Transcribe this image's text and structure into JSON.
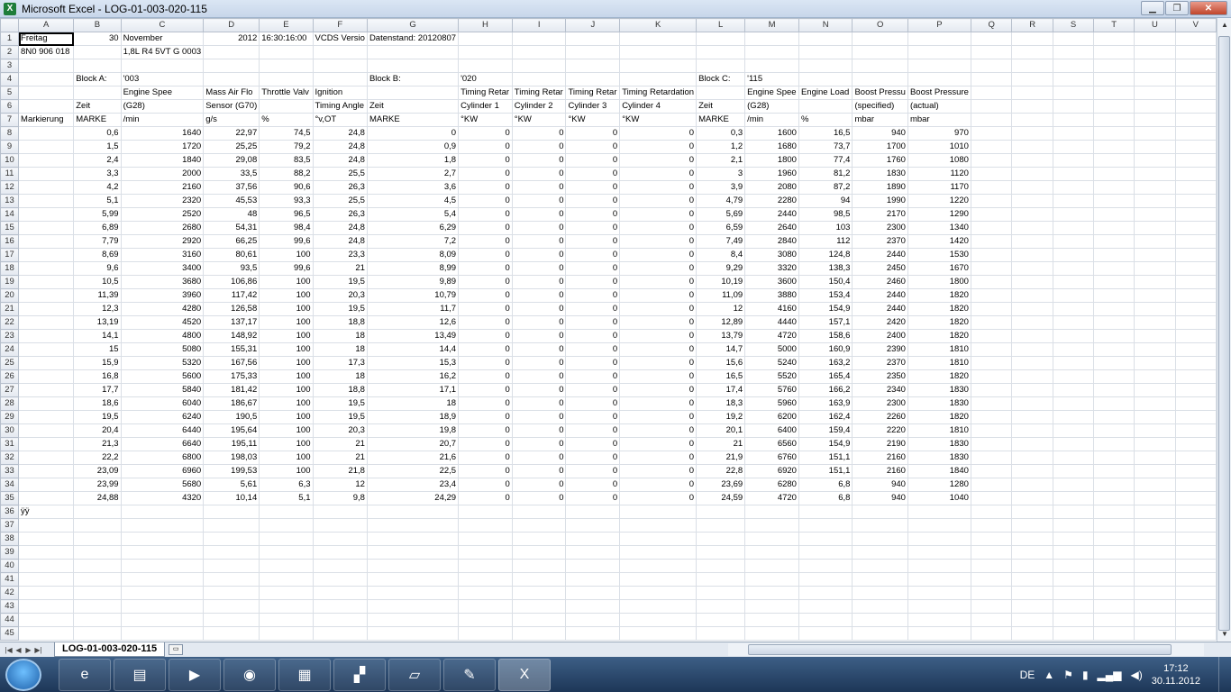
{
  "window": {
    "title": "Microsoft Excel - LOG-01-003-020-115",
    "app_icon": "X",
    "minimize": "▁",
    "maximize": "❐",
    "close": "✕"
  },
  "columns": [
    "A",
    "B",
    "C",
    "D",
    "E",
    "F",
    "G",
    "H",
    "I",
    "J",
    "K",
    "L",
    "M",
    "N",
    "O",
    "P",
    "Q",
    "R",
    "S",
    "T",
    "U",
    "V"
  ],
  "rows": [
    [
      "Freitag",
      "30",
      "November",
      "2012",
      "16:30:16:00",
      "VCDS Versio",
      "Datenstand: 20120807",
      "",
      "",
      "",
      "",
      "",
      "",
      "",
      "",
      "",
      "",
      "",
      "",
      "",
      "",
      ""
    ],
    [
      "8N0 906 018",
      "",
      "1,8L R4 5VT   G  0003",
      "",
      "",
      "",
      "",
      "",
      "",
      "",
      "",
      "",
      "",
      "",
      "",
      "",
      "",
      "",
      "",
      "",
      "",
      ""
    ],
    [
      "",
      "",
      "",
      "",
      "",
      "",
      "",
      "",
      "",
      "",
      "",
      "",
      "",
      "",
      "",
      "",
      "",
      "",
      "",
      "",
      "",
      ""
    ],
    [
      "",
      "Block A:",
      "'003",
      "",
      "",
      "",
      "Block B:",
      "'020",
      "",
      "",
      "",
      "Block C:",
      "'115",
      "",
      "",
      "",
      "",
      "",
      "",
      "",
      "",
      ""
    ],
    [
      "",
      "",
      "Engine Spee",
      "Mass Air Flo",
      "Throttle Valv",
      "Ignition",
      "",
      "Timing Retar",
      "Timing Retar",
      "Timing Retar",
      "Timing Retardation",
      "",
      "Engine Spee",
      "Engine Load",
      "Boost Pressu",
      "Boost Pressure",
      "",
      "",
      "",
      "",
      "",
      ""
    ],
    [
      "",
      "Zeit",
      "(G28)",
      "Sensor (G70)",
      "",
      "Timing Angle",
      "Zeit",
      "Cylinder 1",
      "Cylinder 2",
      "Cylinder 3",
      "Cylinder 4",
      "Zeit",
      "(G28)",
      "",
      "(specified)",
      "(actual)",
      "",
      "",
      "",
      "",
      "",
      ""
    ],
    [
      "Markierung",
      "MARKE",
      "/min",
      "g/s",
      "%",
      "°v,OT",
      "MARKE",
      "°KW",
      "°KW",
      "°KW",
      "°KW",
      "MARKE",
      "/min",
      "%",
      "mbar",
      "mbar",
      "",
      "",
      "",
      "",
      "",
      ""
    ],
    [
      "",
      "0,6",
      "1640",
      "22,97",
      "74,5",
      "24,8",
      "0",
      "0",
      "0",
      "0",
      "0",
      "0,3",
      "1600",
      "16,5",
      "940",
      "970",
      "",
      "",
      "",
      "",
      "",
      ""
    ],
    [
      "",
      "1,5",
      "1720",
      "25,25",
      "79,2",
      "24,8",
      "0,9",
      "0",
      "0",
      "0",
      "0",
      "1,2",
      "1680",
      "73,7",
      "1700",
      "1010",
      "",
      "",
      "",
      "",
      "",
      ""
    ],
    [
      "",
      "2,4",
      "1840",
      "29,08",
      "83,5",
      "24,8",
      "1,8",
      "0",
      "0",
      "0",
      "0",
      "2,1",
      "1800",
      "77,4",
      "1760",
      "1080",
      "",
      "",
      "",
      "",
      "",
      ""
    ],
    [
      "",
      "3,3",
      "2000",
      "33,5",
      "88,2",
      "25,5",
      "2,7",
      "0",
      "0",
      "0",
      "0",
      "3",
      "1960",
      "81,2",
      "1830",
      "1120",
      "",
      "",
      "",
      "",
      "",
      ""
    ],
    [
      "",
      "4,2",
      "2160",
      "37,56",
      "90,6",
      "26,3",
      "3,6",
      "0",
      "0",
      "0",
      "0",
      "3,9",
      "2080",
      "87,2",
      "1890",
      "1170",
      "",
      "",
      "",
      "",
      "",
      ""
    ],
    [
      "",
      "5,1",
      "2320",
      "45,53",
      "93,3",
      "25,5",
      "4,5",
      "0",
      "0",
      "0",
      "0",
      "4,79",
      "2280",
      "94",
      "1990",
      "1220",
      "",
      "",
      "",
      "",
      "",
      ""
    ],
    [
      "",
      "5,99",
      "2520",
      "48",
      "96,5",
      "26,3",
      "5,4",
      "0",
      "0",
      "0",
      "0",
      "5,69",
      "2440",
      "98,5",
      "2170",
      "1290",
      "",
      "",
      "",
      "",
      "",
      ""
    ],
    [
      "",
      "6,89",
      "2680",
      "54,31",
      "98,4",
      "24,8",
      "6,29",
      "0",
      "0",
      "0",
      "0",
      "6,59",
      "2640",
      "103",
      "2300",
      "1340",
      "",
      "",
      "",
      "",
      "",
      ""
    ],
    [
      "",
      "7,79",
      "2920",
      "66,25",
      "99,6",
      "24,8",
      "7,2",
      "0",
      "0",
      "0",
      "0",
      "7,49",
      "2840",
      "112",
      "2370",
      "1420",
      "",
      "",
      "",
      "",
      "",
      ""
    ],
    [
      "",
      "8,69",
      "3160",
      "80,61",
      "100",
      "23,3",
      "8,09",
      "0",
      "0",
      "0",
      "0",
      "8,4",
      "3080",
      "124,8",
      "2440",
      "1530",
      "",
      "",
      "",
      "",
      "",
      ""
    ],
    [
      "",
      "9,6",
      "3400",
      "93,5",
      "99,6",
      "21",
      "8,99",
      "0",
      "0",
      "0",
      "0",
      "9,29",
      "3320",
      "138,3",
      "2450",
      "1670",
      "",
      "",
      "",
      "",
      "",
      ""
    ],
    [
      "",
      "10,5",
      "3680",
      "106,86",
      "100",
      "19,5",
      "9,89",
      "0",
      "0",
      "0",
      "0",
      "10,19",
      "3600",
      "150,4",
      "2460",
      "1800",
      "",
      "",
      "",
      "",
      "",
      ""
    ],
    [
      "",
      "11,39",
      "3960",
      "117,42",
      "100",
      "20,3",
      "10,79",
      "0",
      "0",
      "0",
      "0",
      "11,09",
      "3880",
      "153,4",
      "2440",
      "1820",
      "",
      "",
      "",
      "",
      "",
      ""
    ],
    [
      "",
      "12,3",
      "4280",
      "126,58",
      "100",
      "19,5",
      "11,7",
      "0",
      "0",
      "0",
      "0",
      "12",
      "4160",
      "154,9",
      "2440",
      "1820",
      "",
      "",
      "",
      "",
      "",
      ""
    ],
    [
      "",
      "13,19",
      "4520",
      "137,17",
      "100",
      "18,8",
      "12,6",
      "0",
      "0",
      "0",
      "0",
      "12,89",
      "4440",
      "157,1",
      "2420",
      "1820",
      "",
      "",
      "",
      "",
      "",
      ""
    ],
    [
      "",
      "14,1",
      "4800",
      "148,92",
      "100",
      "18",
      "13,49",
      "0",
      "0",
      "0",
      "0",
      "13,79",
      "4720",
      "158,6",
      "2400",
      "1820",
      "",
      "",
      "",
      "",
      "",
      ""
    ],
    [
      "",
      "15",
      "5080",
      "155,31",
      "100",
      "18",
      "14,4",
      "0",
      "0",
      "0",
      "0",
      "14,7",
      "5000",
      "160,9",
      "2390",
      "1810",
      "",
      "",
      "",
      "",
      "",
      ""
    ],
    [
      "",
      "15,9",
      "5320",
      "167,56",
      "100",
      "17,3",
      "15,3",
      "0",
      "0",
      "0",
      "0",
      "15,6",
      "5240",
      "163,2",
      "2370",
      "1810",
      "",
      "",
      "",
      "",
      "",
      ""
    ],
    [
      "",
      "16,8",
      "5600",
      "175,33",
      "100",
      "18",
      "16,2",
      "0",
      "0",
      "0",
      "0",
      "16,5",
      "5520",
      "165,4",
      "2350",
      "1820",
      "",
      "",
      "",
      "",
      "",
      ""
    ],
    [
      "",
      "17,7",
      "5840",
      "181,42",
      "100",
      "18,8",
      "17,1",
      "0",
      "0",
      "0",
      "0",
      "17,4",
      "5760",
      "166,2",
      "2340",
      "1830",
      "",
      "",
      "",
      "",
      "",
      ""
    ],
    [
      "",
      "18,6",
      "6040",
      "186,67",
      "100",
      "19,5",
      "18",
      "0",
      "0",
      "0",
      "0",
      "18,3",
      "5960",
      "163,9",
      "2300",
      "1830",
      "",
      "",
      "",
      "",
      "",
      ""
    ],
    [
      "",
      "19,5",
      "6240",
      "190,5",
      "100",
      "19,5",
      "18,9",
      "0",
      "0",
      "0",
      "0",
      "19,2",
      "6200",
      "162,4",
      "2260",
      "1820",
      "",
      "",
      "",
      "",
      "",
      ""
    ],
    [
      "",
      "20,4",
      "6440",
      "195,64",
      "100",
      "20,3",
      "19,8",
      "0",
      "0",
      "0",
      "0",
      "20,1",
      "6400",
      "159,4",
      "2220",
      "1810",
      "",
      "",
      "",
      "",
      "",
      ""
    ],
    [
      "",
      "21,3",
      "6640",
      "195,11",
      "100",
      "21",
      "20,7",
      "0",
      "0",
      "0",
      "0",
      "21",
      "6560",
      "154,9",
      "2190",
      "1830",
      "",
      "",
      "",
      "",
      "",
      ""
    ],
    [
      "",
      "22,2",
      "6800",
      "198,03",
      "100",
      "21",
      "21,6",
      "0",
      "0",
      "0",
      "0",
      "21,9",
      "6760",
      "151,1",
      "2160",
      "1830",
      "",
      "",
      "",
      "",
      "",
      ""
    ],
    [
      "",
      "23,09",
      "6960",
      "199,53",
      "100",
      "21,8",
      "22,5",
      "0",
      "0",
      "0",
      "0",
      "22,8",
      "6920",
      "151,1",
      "2160",
      "1840",
      "",
      "",
      "",
      "",
      "",
      ""
    ],
    [
      "",
      "23,99",
      "5680",
      "5,61",
      "6,3",
      "12",
      "23,4",
      "0",
      "0",
      "0",
      "0",
      "23,69",
      "6280",
      "6,8",
      "940",
      "1280",
      "",
      "",
      "",
      "",
      "",
      ""
    ],
    [
      "",
      "24,88",
      "4320",
      "10,14",
      "5,1",
      "9,8",
      "24,29",
      "0",
      "0",
      "0",
      "0",
      "24,59",
      "4720",
      "6,8",
      "940",
      "1040",
      "",
      "",
      "",
      "",
      "",
      ""
    ],
    [
      "ÿÿ",
      "",
      "",
      "",
      "",
      "",
      "",
      "",
      "",
      "",
      "",
      "",
      "",
      "",
      "",
      "",
      "",
      "",
      "",
      "",
      "",
      ""
    ],
    [
      "",
      "",
      "",
      "",
      "",
      "",
      "",
      "",
      "",
      "",
      "",
      "",
      "",
      "",
      "",
      "",
      "",
      "",
      "",
      "",
      "",
      ""
    ],
    [
      "",
      "",
      "",
      "",
      "",
      "",
      "",
      "",
      "",
      "",
      "",
      "",
      "",
      "",
      "",
      "",
      "",
      "",
      "",
      "",
      "",
      ""
    ],
    [
      "",
      "",
      "",
      "",
      "",
      "",
      "",
      "",
      "",
      "",
      "",
      "",
      "",
      "",
      "",
      "",
      "",
      "",
      "",
      "",
      "",
      ""
    ],
    [
      "",
      "",
      "",
      "",
      "",
      "",
      "",
      "",
      "",
      "",
      "",
      "",
      "",
      "",
      "",
      "",
      "",
      "",
      "",
      "",
      "",
      ""
    ],
    [
      "",
      "",
      "",
      "",
      "",
      "",
      "",
      "",
      "",
      "",
      "",
      "",
      "",
      "",
      "",
      "",
      "",
      "",
      "",
      "",
      "",
      ""
    ],
    [
      "",
      "",
      "",
      "",
      "",
      "",
      "",
      "",
      "",
      "",
      "",
      "",
      "",
      "",
      "",
      "",
      "",
      "",
      "",
      "",
      "",
      ""
    ],
    [
      "",
      "",
      "",
      "",
      "",
      "",
      "",
      "",
      "",
      "",
      "",
      "",
      "",
      "",
      "",
      "",
      "",
      "",
      "",
      "",
      "",
      ""
    ],
    [
      "",
      "",
      "",
      "",
      "",
      "",
      "",
      "",
      "",
      "",
      "",
      "",
      "",
      "",
      "",
      "",
      "",
      "",
      "",
      "",
      "",
      ""
    ],
    [
      "",
      "",
      "",
      "",
      "",
      "",
      "",
      "",
      "",
      "",
      "",
      "",
      "",
      "",
      "",
      "",
      "",
      "",
      "",
      "",
      "",
      ""
    ]
  ],
  "sheet": {
    "tab_label": "LOG-01-003-020-115",
    "nav_first": "|◀",
    "nav_prev": "◀",
    "nav_next": "▶",
    "nav_last": "▶|"
  },
  "taskbar": {
    "apps": [
      {
        "name": "internet-explorer",
        "glyph": "e"
      },
      {
        "name": "file-explorer",
        "glyph": "▤"
      },
      {
        "name": "media-player",
        "glyph": "▶"
      },
      {
        "name": "firefox",
        "glyph": "◉"
      },
      {
        "name": "winrar",
        "glyph": "▦"
      },
      {
        "name": "network-app",
        "glyph": "▞"
      },
      {
        "name": "notepad-app",
        "glyph": "▱"
      },
      {
        "name": "paint",
        "glyph": "✎"
      },
      {
        "name": "excel",
        "glyph": "X"
      }
    ],
    "active_app": "excel",
    "language": "DE",
    "time": "17:12",
    "date": "30.11.2012"
  },
  "colors": {
    "excel_green": "#1e7d3a",
    "taskbar": "#1d3657",
    "header_bg": "#e4e9f0",
    "gridline": "#dadfe6"
  }
}
